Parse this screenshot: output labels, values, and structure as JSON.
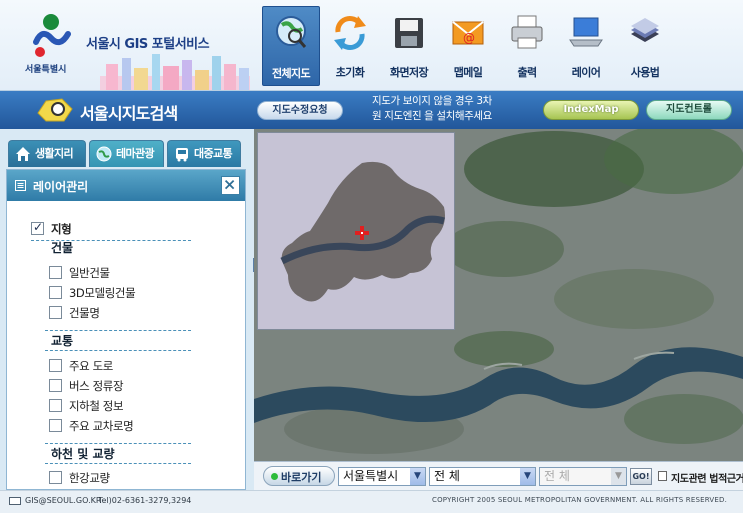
{
  "header": {
    "logo_caption": "서울특별시",
    "service_title": "서울시 GIS 포털서비스",
    "toolbar": [
      {
        "label": "전체지도",
        "icon": "globe-search-icon",
        "active": true
      },
      {
        "label": "초기화",
        "icon": "refresh-arrows-icon",
        "active": false
      },
      {
        "label": "화면저장",
        "icon": "floppy-disk-icon",
        "active": false
      },
      {
        "label": "맵메일",
        "icon": "mail-envelope-icon",
        "active": false
      },
      {
        "label": "출력",
        "icon": "printer-icon",
        "active": false
      },
      {
        "label": "레이어",
        "icon": "laptop-layers-icon",
        "active": false
      },
      {
        "label": "사용법",
        "icon": "book-help-icon",
        "active": false
      }
    ]
  },
  "titlebar": {
    "title": "서울시지도검색",
    "report_button": "지도수정요청",
    "notice_line1": "지도가 보이지 않을 경우 3차",
    "notice_line2": "원 지도엔진 을 설치해주세요",
    "indexmap_button": "IndexMap",
    "control_button": "지도컨트롤"
  },
  "sidebar": {
    "tabs": [
      {
        "label": "생활지리",
        "icon": "house-icon"
      },
      {
        "label": "테마관광",
        "icon": "globe-icon"
      },
      {
        "label": "대중교통",
        "icon": "bus-icon"
      }
    ],
    "panel_title": "레이어관리",
    "layers": {
      "terrain": {
        "label": "지형",
        "checked": true
      },
      "building": {
        "group": "건물",
        "items": [
          {
            "label": "일반건물",
            "checked": false
          },
          {
            "label": "3D모델링건물",
            "checked": false
          },
          {
            "label": "건물명",
            "checked": false
          }
        ]
      },
      "traffic": {
        "group": "교통",
        "items": [
          {
            "label": "주요 도로",
            "checked": false
          },
          {
            "label": "버스 정류장",
            "checked": false
          },
          {
            "label": "지하철 정보",
            "checked": false
          },
          {
            "label": "주요 교차로명",
            "checked": false
          }
        ]
      },
      "river": {
        "group": "하천 및 교량",
        "items": [
          {
            "label": "한강교량",
            "checked": false
          }
        ]
      }
    }
  },
  "bottombar": {
    "goto_button": "바로가기",
    "city_select": "서울특별시",
    "gu_select": "전 체",
    "dong_select": "전 체",
    "go_button": "GO!",
    "related_link": "지도관련 법적근거"
  },
  "footer": {
    "email": "GIS@SEOUL.GO.KR",
    "tel": "Tel)02-6361-3279,3294",
    "copyright": "COPYRIGHT  2005 SEOUL METROPOLITAN GOVERNMENT. ALL RIGHTS RESERVED."
  }
}
